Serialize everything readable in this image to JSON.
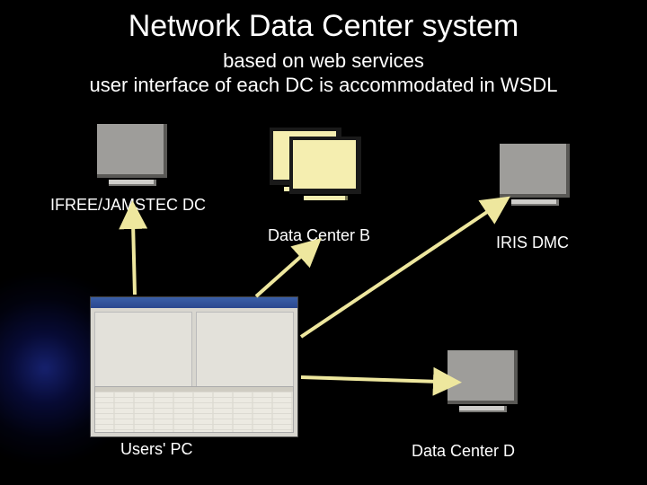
{
  "title": "Network Data Center system",
  "subtitle1": "based on web services",
  "subtitle2": "user interface of each DC is accommodated in WSDL",
  "nodes": {
    "ifree": {
      "label": "IFREE/JAMSTEC  DC"
    },
    "dcb": {
      "label": "Data Center B"
    },
    "iris": {
      "label": "IRIS DMC"
    },
    "user": {
      "label": "Users' PC"
    },
    "dcd": {
      "label": "Data Center D"
    }
  },
  "colors": {
    "arrow": "#eee79e",
    "background": "#000000",
    "flare": "#2038c8"
  }
}
